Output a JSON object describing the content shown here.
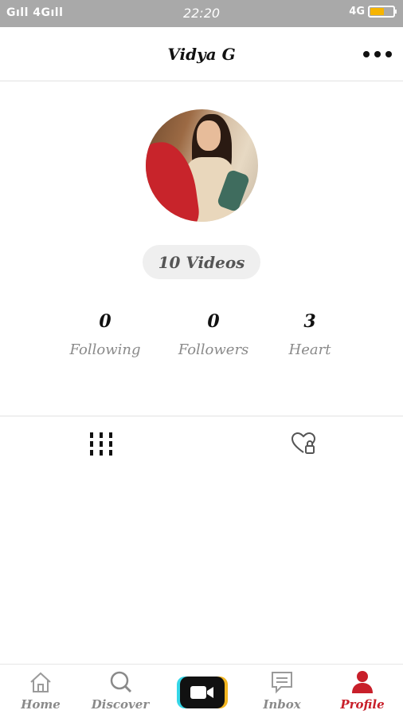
{
  "status_bar": {
    "left_text": "Gıll 4Gıll",
    "time": "22:20",
    "right_text": "4G"
  },
  "header": {
    "title": "Vidya G",
    "more_icon": "more-horizontal-icon"
  },
  "profile": {
    "videos_label": "10 Videos",
    "stats": [
      {
        "value": "0",
        "label": "Following"
      },
      {
        "value": "0",
        "label": "Followers"
      },
      {
        "value": "3",
        "label": "Heart"
      }
    ]
  },
  "tabs": {
    "icons": [
      "grid-icon",
      "liked-lock-icon"
    ]
  },
  "bottom_nav": {
    "items": [
      {
        "label": "Home",
        "icon": "home-icon"
      },
      {
        "label": "Discover",
        "icon": "search-icon"
      },
      {
        "label": "",
        "icon": "video-record-icon"
      },
      {
        "label": "Inbox",
        "icon": "message-icon"
      },
      {
        "label": "Profile",
        "icon": "profile-icon"
      }
    ]
  },
  "colors": {
    "status_bar": "#a9a9a9",
    "active": "#c81f2a",
    "muted": "#8a8a8a"
  }
}
